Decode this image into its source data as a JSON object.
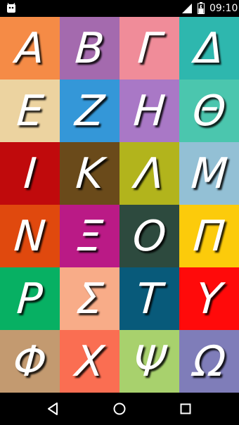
{
  "status_bar": {
    "time": "09:10",
    "icons": [
      "android-icon",
      "signal-icon",
      "battery-icon"
    ]
  },
  "tiles": [
    {
      "letter": "Α",
      "color": "#F58B46"
    },
    {
      "letter": "Β",
      "color": "#A46AAE"
    },
    {
      "letter": "Γ",
      "color": "#F08C99"
    },
    {
      "letter": "Δ",
      "color": "#2EB7AE"
    },
    {
      "letter": "Ε",
      "color": "#ECD3A0"
    },
    {
      "letter": "Ζ",
      "color": "#3497D8"
    },
    {
      "letter": "Η",
      "color": "#A978C6"
    },
    {
      "letter": "Θ",
      "color": "#4BC6AE"
    },
    {
      "letter": "Ι",
      "color": "#C00A0C"
    },
    {
      "letter": "Κ",
      "color": "#6A4A1A"
    },
    {
      "letter": "Λ",
      "color": "#B2B41C"
    },
    {
      "letter": "Μ",
      "color": "#93C0D5"
    },
    {
      "letter": "Ν",
      "color": "#E0490E"
    },
    {
      "letter": "Ξ",
      "color": "#BA1A86"
    },
    {
      "letter": "Ο",
      "color": "#2D4A3E"
    },
    {
      "letter": "Π",
      "color": "#FCCB0B"
    },
    {
      "letter": "Ρ",
      "color": "#07B063"
    },
    {
      "letter": "Σ",
      "color": "#F8AC88"
    },
    {
      "letter": "Τ",
      "color": "#085A7A"
    },
    {
      "letter": "Υ",
      "color": "#FF0A0A"
    },
    {
      "letter": "Φ",
      "color": "#C39A70"
    },
    {
      "letter": "Χ",
      "color": "#FA6E52"
    },
    {
      "letter": "Ψ",
      "color": "#A8D16D"
    },
    {
      "letter": "Ω",
      "color": "#7F7DB9"
    }
  ],
  "nav_bar": {
    "icons": [
      "back-icon",
      "home-icon",
      "recents-icon"
    ]
  }
}
